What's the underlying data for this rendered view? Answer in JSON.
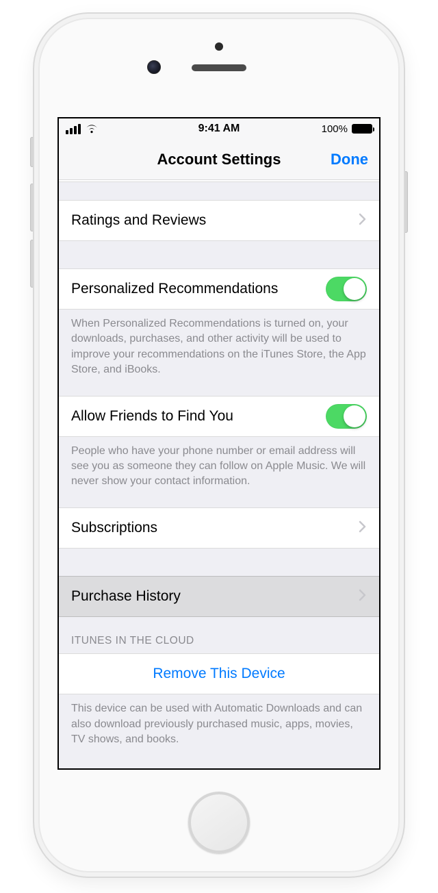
{
  "status": {
    "time": "9:41 AM",
    "battery_pct": "100%"
  },
  "nav": {
    "title": "Account Settings",
    "done": "Done"
  },
  "rows": {
    "ratings": "Ratings and Reviews",
    "personalized": "Personalized Recommendations",
    "personalized_footer": "When Personalized Recommendations is turned on, your downloads, purchases, and other activity will be used to improve your recommendations on the iTunes Store, the App Store, and iBooks.",
    "friends": "Allow Friends to Find You",
    "friends_footer": "People who have your phone number or email address will see you as someone they can follow on Apple Music. We will never show your contact information.",
    "subscriptions": "Subscriptions",
    "purchase_history": "Purchase History",
    "icloud_header": "iTunes in the Cloud",
    "remove_device": "Remove This Device",
    "remove_footer": "This device can be used with Automatic Downloads and can also download previously purchased music, apps, movies, TV shows, and books."
  }
}
